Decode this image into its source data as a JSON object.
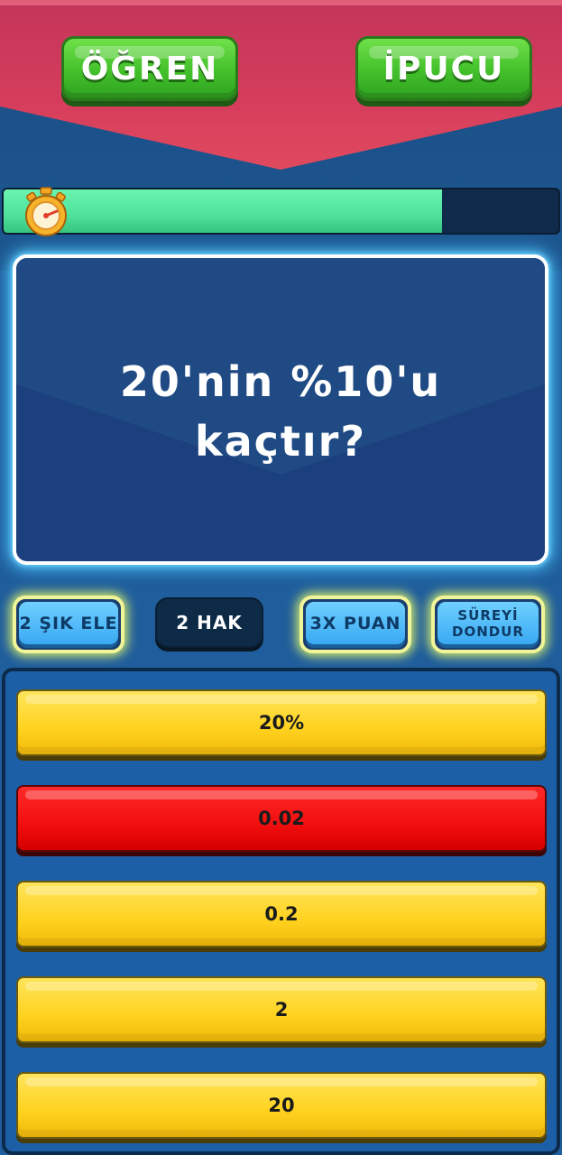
{
  "header": {
    "learn_label": "ÖĞREN",
    "hint_label": "İPUCU"
  },
  "timer": {
    "remaining_fraction": 0.79,
    "icon": "stopwatch-icon"
  },
  "question": {
    "text": "20'nin %10'u\nkaçtır?"
  },
  "jokers": {
    "eliminate_label": "2 ŞIK ELE",
    "lives_label": "2 HAK",
    "triple_label": "3X PUAN",
    "freeze_label": "SÜREYİ DONDUR"
  },
  "answers": [
    {
      "label": "20%",
      "state": "normal"
    },
    {
      "label": "0.02",
      "state": "wrong"
    },
    {
      "label": "0.2",
      "state": "normal"
    },
    {
      "label": "2",
      "state": "normal"
    },
    {
      "label": "20",
      "state": "normal"
    }
  ],
  "colors": {
    "answer_default": "#ffd21f",
    "answer_wrong": "#f20e0e",
    "timer_fill": "#4fe19a",
    "top_button": "#42c02a"
  }
}
